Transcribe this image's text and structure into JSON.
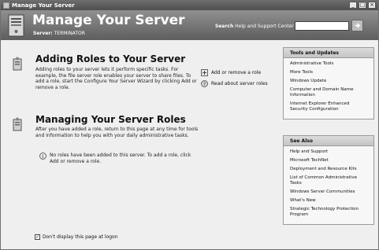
{
  "window": {
    "title": "Manage Your Server"
  },
  "header": {
    "title": "Manage Your Server",
    "server_label": "Server:",
    "server_name": "TERMINATOR",
    "search_label_bold": "Search",
    "search_label_rest": " Help and Support Center",
    "search_value": ""
  },
  "adding": {
    "title": "Adding Roles to Your Server",
    "description": "Adding roles to your server lets it perform specific tasks. For example, the file server role enables your server to share files. To add a role, start the Configure Your Server Wizard by clicking Add or remove a role.",
    "actions": [
      {
        "label": "Add or remove a role",
        "icon": "add-role-icon"
      },
      {
        "label": "Read about server roles",
        "icon": "help-icon"
      }
    ]
  },
  "managing": {
    "title": "Managing Your Server Roles",
    "description": "After you have added a role, return to this page at any time for tools and information to help you with your daily administrative tasks.",
    "notice": "No roles have been added to this server. To add a role, click Add or remove a role."
  },
  "footer": {
    "checkbox_checked": true,
    "checkbox_label": "Don't display this page at logon"
  },
  "tools_panel": {
    "title": "Tools and Updates",
    "items": [
      "Administrative Tools",
      "More Tools",
      "Windows Update",
      "Computer and Domain Name Information",
      "Internet Explorer Enhanced Security Configuration"
    ]
  },
  "see_also_panel": {
    "title": "See Also",
    "items": [
      "Help and Support",
      "Microsoft TechNet",
      "Deployment and Resource Kits",
      "List of Common Administrative Tasks",
      "Windows Server Communities",
      "What's New",
      "Strategic Technology Protection Program"
    ]
  }
}
